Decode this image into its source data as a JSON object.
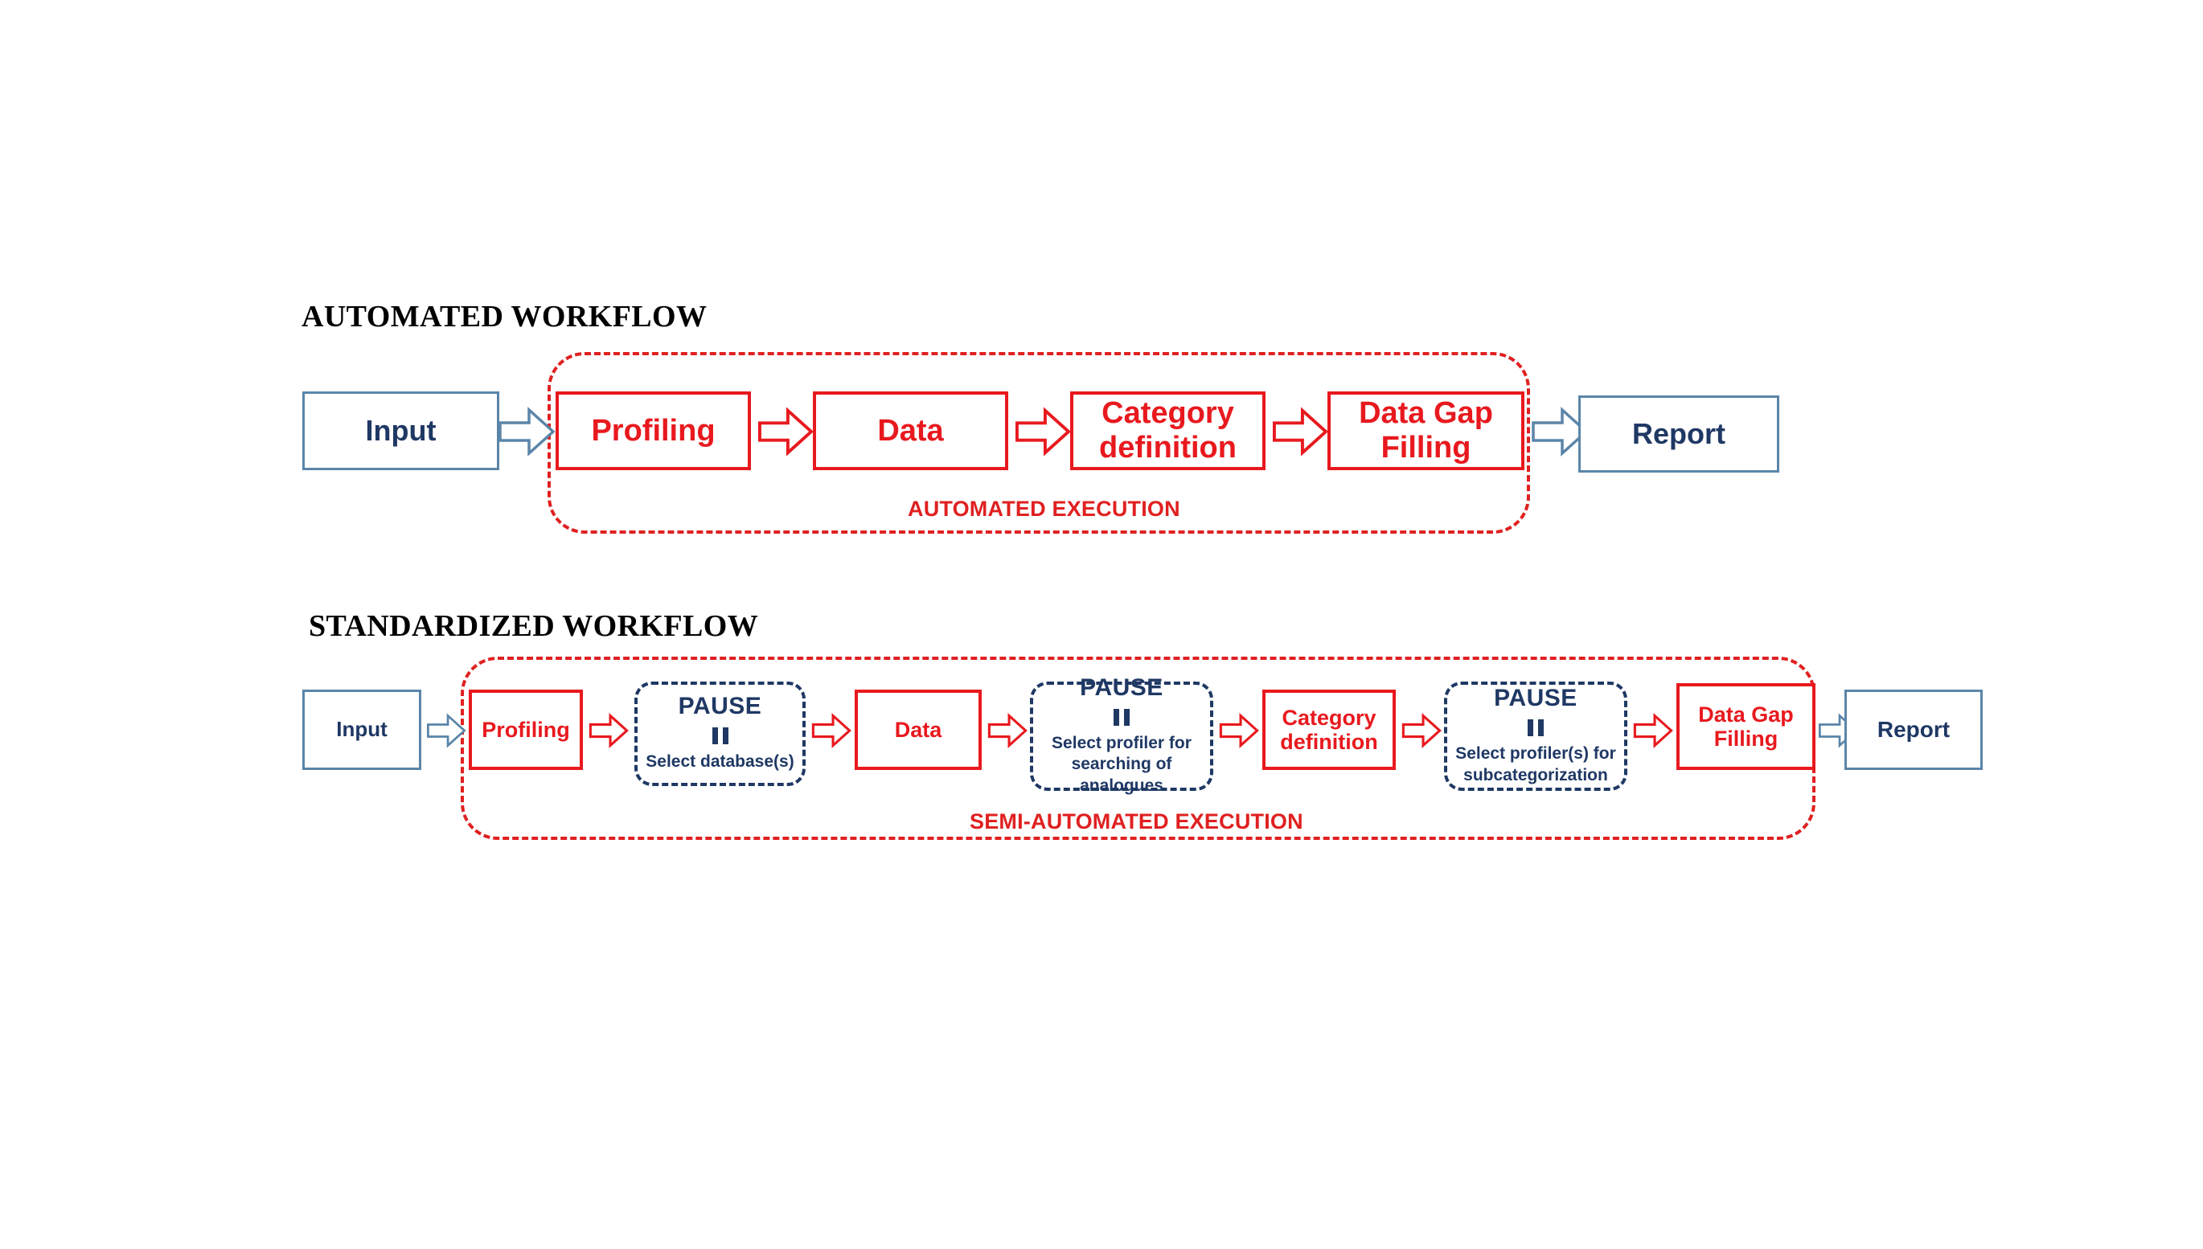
{
  "page": {
    "background": "#FFFFFF",
    "colors": {
      "red": "#E8191E",
      "dashed_red": "#E02020",
      "navy": "#1F3864",
      "steel_blue": "#5B85A8",
      "black": "#000000"
    }
  },
  "workflows": [
    {
      "id": "automated",
      "title": "AUTOMATED WORKFLOW",
      "execution_label": "AUTOMATED EXECUTION",
      "input_label": "Input",
      "report_label": "Report",
      "steps": [
        {
          "label": "Profiling"
        },
        {
          "label": "Data"
        },
        {
          "label": "Category definition"
        },
        {
          "label": "Data Gap Filling"
        }
      ]
    },
    {
      "id": "standardized",
      "title": "STANDARDIZED WORKFLOW",
      "execution_label": "SEMI-AUTOMATED EXECUTION",
      "input_label": "Input",
      "report_label": "Report",
      "steps": [
        {
          "label": "Profiling"
        },
        {
          "label": "Data"
        },
        {
          "label": "Category definition"
        },
        {
          "label": "Data Gap Filling"
        }
      ],
      "pauses": [
        {
          "title": "PAUSE",
          "glyph": "pause-bars-icon",
          "subtitle": "Select database(s)"
        },
        {
          "title": "PAUSE",
          "glyph": "pause-bars-icon",
          "subtitle": "Select profiler for\nsearching of analogues"
        },
        {
          "title": "PAUSE",
          "glyph": "pause-bars-icon",
          "subtitle": "Select profiler(s) for\nsubcategorization"
        }
      ]
    }
  ]
}
